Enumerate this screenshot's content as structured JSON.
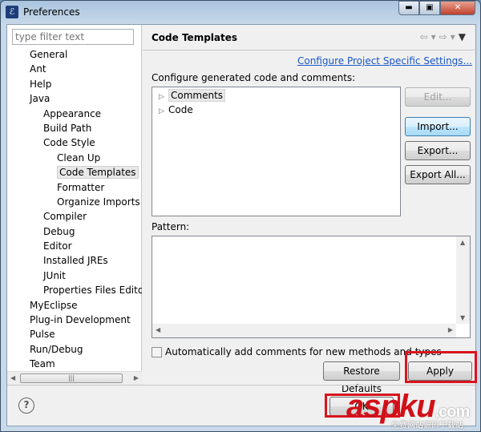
{
  "window": {
    "title": "Preferences",
    "controls": [
      "minimize",
      "maximize",
      "close"
    ]
  },
  "filter": {
    "placeholder": "type filter text"
  },
  "tree": [
    {
      "label": "General",
      "level": 0
    },
    {
      "label": "Ant",
      "level": 0
    },
    {
      "label": "Help",
      "level": 0
    },
    {
      "label": "Java",
      "level": 0
    },
    {
      "label": "Appearance",
      "level": 1
    },
    {
      "label": "Build Path",
      "level": 1
    },
    {
      "label": "Code Style",
      "level": 1
    },
    {
      "label": "Clean Up",
      "level": 2
    },
    {
      "label": "Code Templates",
      "level": 2,
      "selected": true
    },
    {
      "label": "Formatter",
      "level": 2
    },
    {
      "label": "Organize Imports",
      "level": 2
    },
    {
      "label": "Compiler",
      "level": 1
    },
    {
      "label": "Debug",
      "level": 1
    },
    {
      "label": "Editor",
      "level": 1
    },
    {
      "label": "Installed JREs",
      "level": 1
    },
    {
      "label": "JUnit",
      "level": 1
    },
    {
      "label": "Properties Files Edito",
      "level": 1
    },
    {
      "label": "MyEclipse",
      "level": 0
    },
    {
      "label": "Plug-in Development",
      "level": 0
    },
    {
      "label": "Pulse",
      "level": 0
    },
    {
      "label": "Run/Debug",
      "level": 0
    },
    {
      "label": "Team",
      "level": 0
    }
  ],
  "page": {
    "title": "Code Templates",
    "configure_link": "Configure Project Specific Settings...",
    "configure_label": "Configure generated code and comments:",
    "templates": [
      "Comments",
      "Code"
    ],
    "buttons": {
      "edit": "Edit...",
      "import": "Import...",
      "export": "Export...",
      "export_all": "Export All..."
    },
    "pattern_label": "Pattern:",
    "auto_comments": {
      "label": "Automatically add comments for new methods and types",
      "checked": false
    },
    "restore_defaults": "Restore Defaults",
    "apply": "Apply"
  },
  "footer": {
    "ok": "OK",
    "help_icon": "?"
  },
  "watermark": {
    "brand": "aspku",
    "suffix": ".com",
    "sub": "免费网站源码下载站"
  },
  "colors": {
    "highlight": "#d9141e",
    "link": "#1a56c4"
  }
}
